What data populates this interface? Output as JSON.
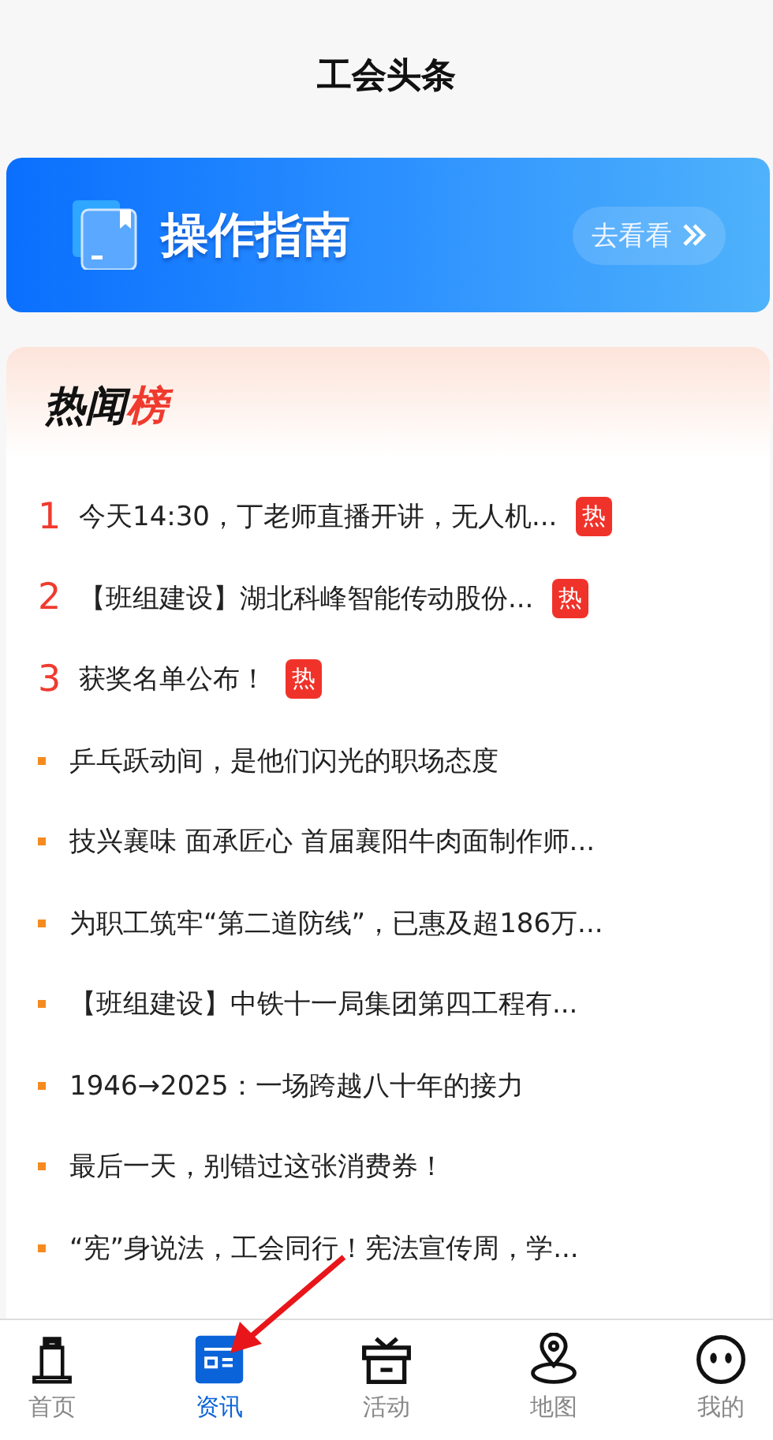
{
  "header": {
    "title": "工会头条"
  },
  "banner": {
    "title": "操作指南",
    "action": "去看看"
  },
  "hot_list": {
    "title_main": "热闻",
    "title_accent": "榜",
    "items": [
      {
        "kind": "ranked",
        "rank": "1",
        "text": "今天14:30，丁老师直播开讲，无人机...",
        "badge": "热"
      },
      {
        "kind": "ranked",
        "rank": "2",
        "text": "【班组建设】湖北科峰智能传动股份...",
        "badge": "热"
      },
      {
        "kind": "ranked",
        "rank": "3",
        "text": "获奖名单公布！",
        "badge": "热"
      },
      {
        "kind": "bullet",
        "text": "乒乓跃动间，是他们闪光的职场态度"
      },
      {
        "kind": "bullet",
        "text": "技兴襄味 面承匠心 首届襄阳牛肉面制作师..."
      },
      {
        "kind": "bullet",
        "text": "为职工筑牢“第二道防线”，已惠及超186万..."
      },
      {
        "kind": "bullet",
        "text": "【班组建设】中铁十一局集团第四工程有..."
      },
      {
        "kind": "bullet",
        "text": "1946→2025：一场跨越八十年的接力"
      },
      {
        "kind": "bullet",
        "text": "最后一天，别错过这张消费券！"
      },
      {
        "kind": "bullet",
        "text": "“宪”身说法，工会同行！宪法宣传周，学..."
      }
    ]
  },
  "tab_bar": [
    {
      "label": "首页",
      "selected": false
    },
    {
      "label": "资讯",
      "selected": true
    },
    {
      "label": "活动",
      "selected": false
    },
    {
      "label": "地图",
      "selected": false
    },
    {
      "label": "我的",
      "selected": false
    }
  ]
}
